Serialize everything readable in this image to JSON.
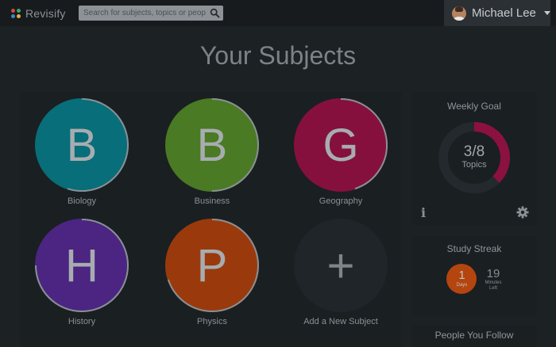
{
  "app": {
    "brand_name": "Revisify",
    "brand_colors": [
      "#d9473a",
      "#3aa86b",
      "#3d86c6",
      "#e0b03a"
    ]
  },
  "search": {
    "placeholder": "Search for subjects, topics or people",
    "icon": "search-icon"
  },
  "user": {
    "name": "Michael Lee",
    "icon": "chevron-down-icon"
  },
  "page": {
    "title": "Your Subjects"
  },
  "subjects": [
    {
      "letter": "B",
      "name": "Biology",
      "color": "#076e7a",
      "progress": 0.55
    },
    {
      "letter": "B",
      "name": "Business",
      "color": "#4a7a23",
      "progress": 0.5
    },
    {
      "letter": "G",
      "name": "Geography",
      "color": "#85103e",
      "progress": 0.45
    },
    {
      "letter": "H",
      "name": "History",
      "color": "#4b2581",
      "progress": 0.75
    },
    {
      "letter": "P",
      "name": "Physics",
      "color": "#9a3a0c",
      "progress": 0.7
    }
  ],
  "add_subject": {
    "symbol": "+",
    "label": "Add a New Subject"
  },
  "weekly_goal": {
    "title": "Weekly Goal",
    "value": "3/8",
    "unit": "Topics",
    "completed": 3,
    "goal": 8,
    "color": "#8b1140"
  },
  "study_streak": {
    "title": "Study Streak",
    "days_value": "1",
    "days_unit": "Days",
    "minutes_value": "19",
    "minutes_unit_line1": "Minutes",
    "minutes_unit_line2": "Left"
  },
  "people_you_follow": {
    "title": "People You Follow"
  }
}
